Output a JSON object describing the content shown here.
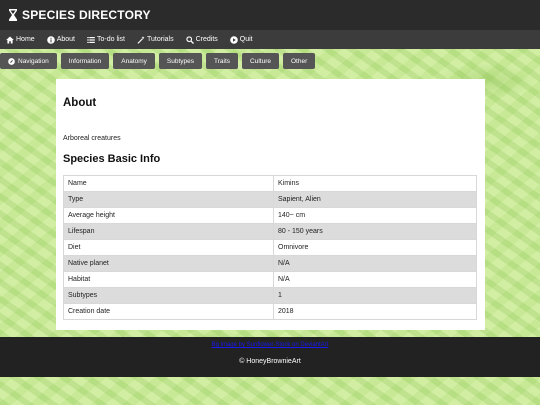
{
  "header": {
    "logo_icon": "hourglass-icon",
    "title": "SPECIES DIRECTORY"
  },
  "menu": [
    {
      "label": "Home",
      "icon": "home-icon"
    },
    {
      "label": "About",
      "icon": "info-icon"
    },
    {
      "label": "To-do list",
      "icon": "list-icon"
    },
    {
      "label": "Tutorials",
      "icon": "wand-icon"
    },
    {
      "label": "Credits",
      "icon": "search-icon"
    },
    {
      "label": "Quit",
      "icon": "play-icon"
    }
  ],
  "tabs": [
    {
      "label": "Navigation",
      "icon": "compass-icon"
    },
    {
      "label": "Information"
    },
    {
      "label": "Anatomy"
    },
    {
      "label": "Subtypes"
    },
    {
      "label": "Traits"
    },
    {
      "label": "Culture"
    },
    {
      "label": "Other"
    }
  ],
  "content": {
    "about_heading": "About",
    "description": "Arboreal creatures",
    "info_heading": "Species Basic Info",
    "rows": [
      {
        "key": "Name",
        "value": "Kimins"
      },
      {
        "key": "Type",
        "value": "Sapient, Alien"
      },
      {
        "key": "Average height",
        "value": "140~ cm"
      },
      {
        "key": "Lifespan",
        "value": "80 - 150 years"
      },
      {
        "key": "Diet",
        "value": "Omnivore"
      },
      {
        "key": "Native planet",
        "value": "N/A"
      },
      {
        "key": "Habitat",
        "value": "N/A"
      },
      {
        "key": "Subtypes",
        "value": "1"
      },
      {
        "key": "Creation date",
        "value": "2018"
      }
    ]
  },
  "footer": {
    "link_text": "Bg image by Sunflower-Stock on DeviantArt",
    "credit": "© HoneyBrownieArt"
  },
  "colors": {
    "topbar": "#2b2b2b",
    "menubar": "#3c3c3c",
    "tab": "#555555",
    "footer": "#222222",
    "background": "#c6e89a"
  }
}
